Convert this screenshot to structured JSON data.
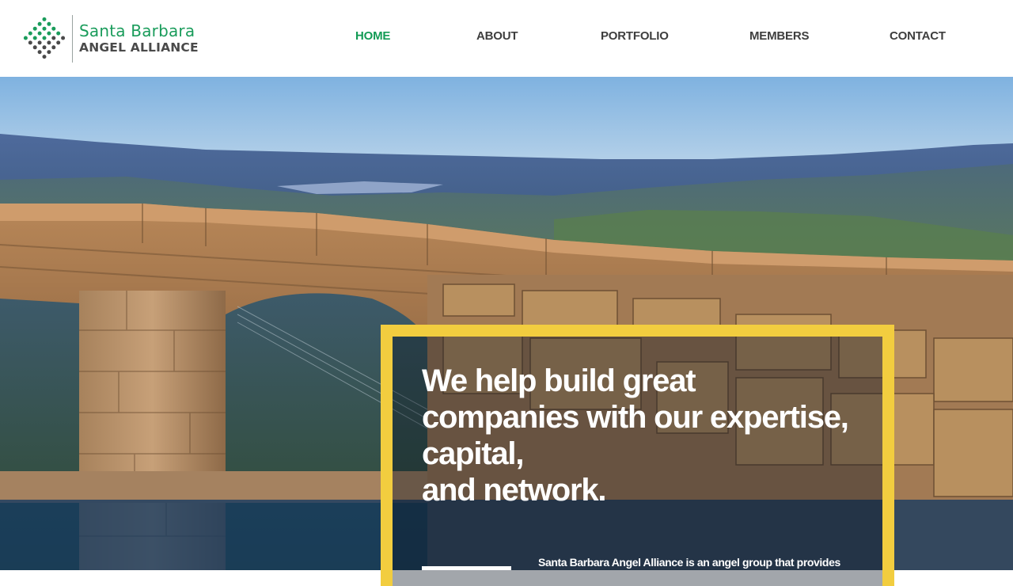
{
  "logo": {
    "line1": "Santa Barbara",
    "line2": "ANGEL ALLIANCE",
    "icon": "diamond-dots-logo-icon"
  },
  "nav": {
    "items": [
      {
        "label": "HOME",
        "active": true
      },
      {
        "label": "ABOUT",
        "active": false
      },
      {
        "label": "PORTFOLIO",
        "active": false
      },
      {
        "label": "MEMBERS",
        "active": false
      },
      {
        "label": "CONTACT",
        "active": false
      }
    ]
  },
  "hero": {
    "headline": [
      "We help build great",
      "companies with our expertise,",
      "capital,",
      "and network."
    ],
    "blurb": "Santa Barbara Angel Alliance is an angel group that provides"
  },
  "colors": {
    "brand_green": "#139b55",
    "frame_yellow": "#f2cd3f",
    "band_blue": "#143a62",
    "nav_text": "#3e3e3e"
  }
}
